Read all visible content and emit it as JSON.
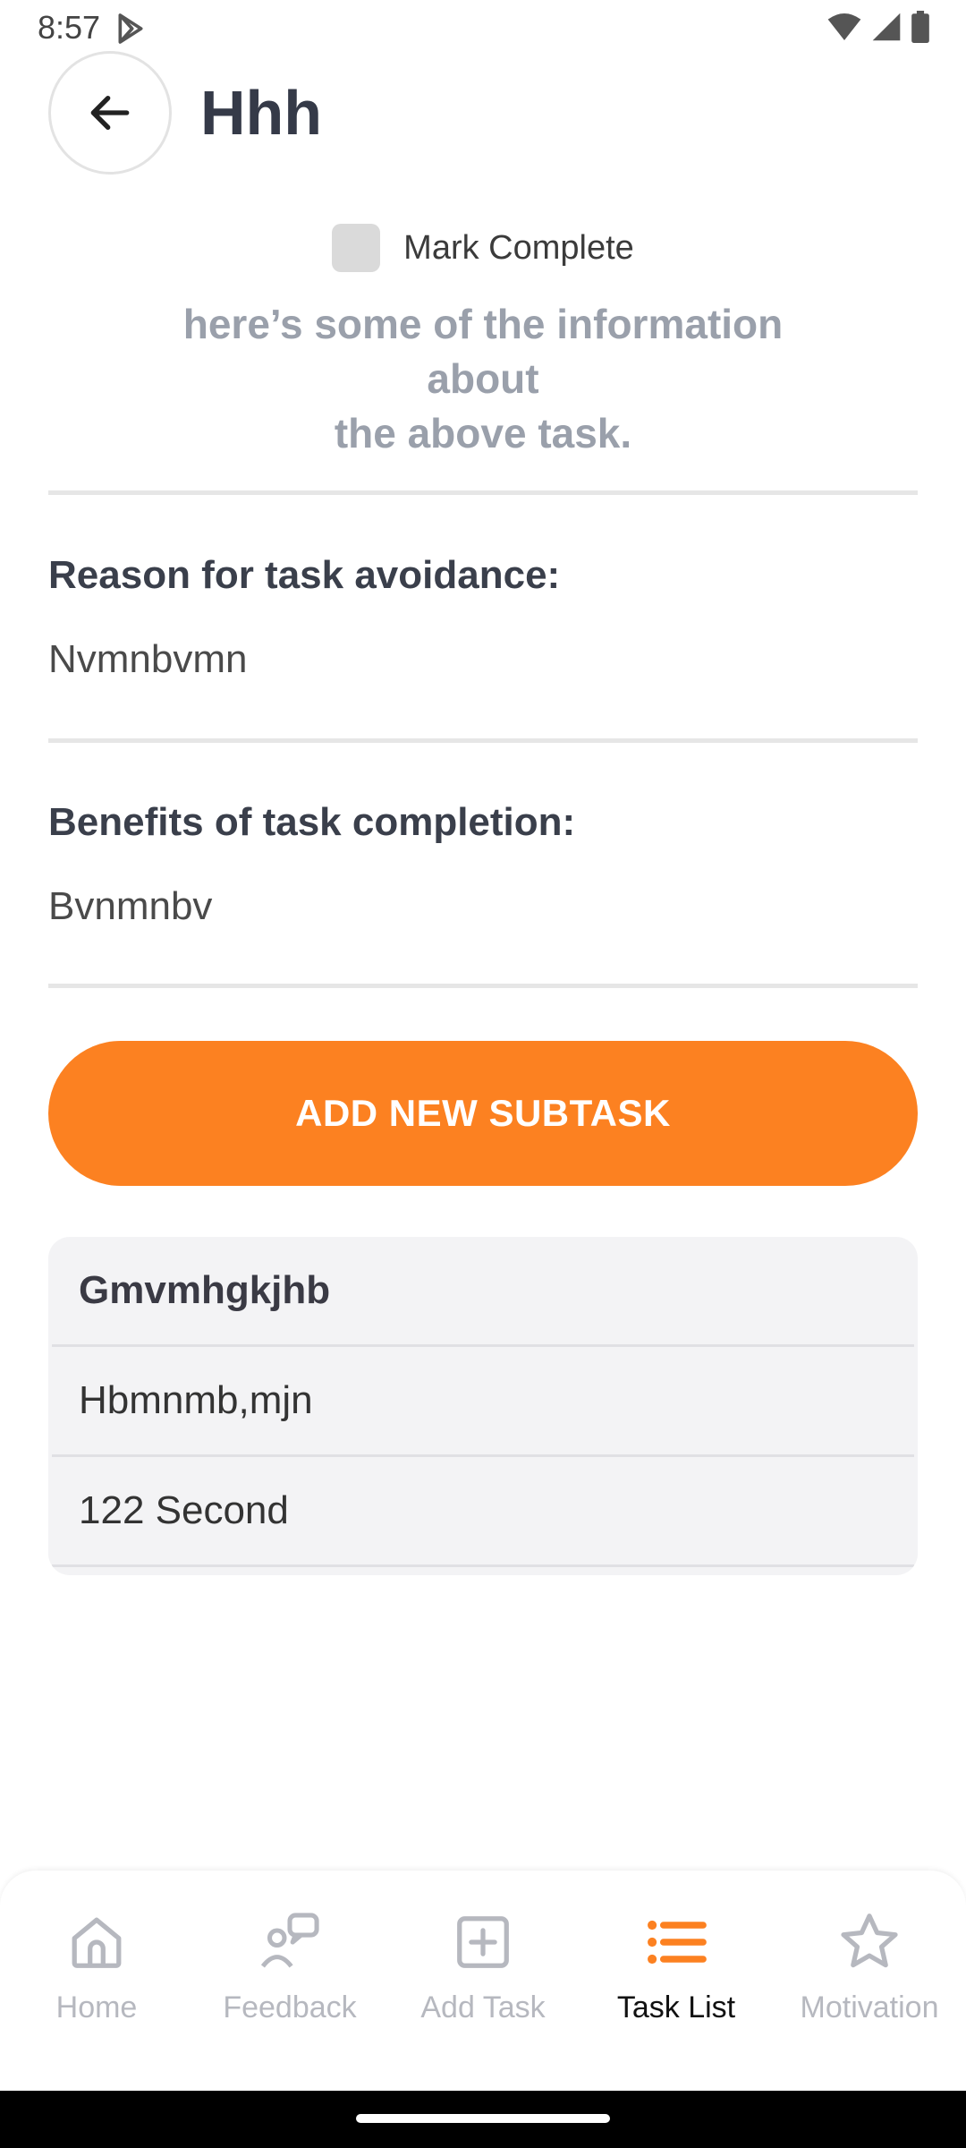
{
  "status": {
    "time": "8:57"
  },
  "header": {
    "title": "Hhh"
  },
  "task": {
    "mark_complete_label": "Mark Complete",
    "info_text": "here’s some of the information\nabout\nthe above task.",
    "avoidance_label": "Reason for task avoidance:",
    "avoidance_value": "Nvmnbvmn",
    "benefits_label": "Benefits of task completion:",
    "benefits_value": "Bvnmnbv"
  },
  "actions": {
    "add_subtask_label": "ADD NEW SUBTASK"
  },
  "subtask": {
    "title": "Gmvmhgkjhb",
    "description": "Hbmnmb,mjn",
    "duration": "122 Second"
  },
  "nav": {
    "items": [
      {
        "label": "Home",
        "icon": "home-icon"
      },
      {
        "label": "Feedback",
        "icon": "feedback-icon"
      },
      {
        "label": "Add Task",
        "icon": "add-task-icon"
      },
      {
        "label": "Task List",
        "icon": "task-list-icon"
      },
      {
        "label": "Motivation",
        "icon": "star-icon"
      }
    ],
    "active_index": 3
  },
  "colors": {
    "accent": "#fc8121",
    "muted_text": "#9aa0ab",
    "nav_inactive": "#b6b8bf"
  }
}
